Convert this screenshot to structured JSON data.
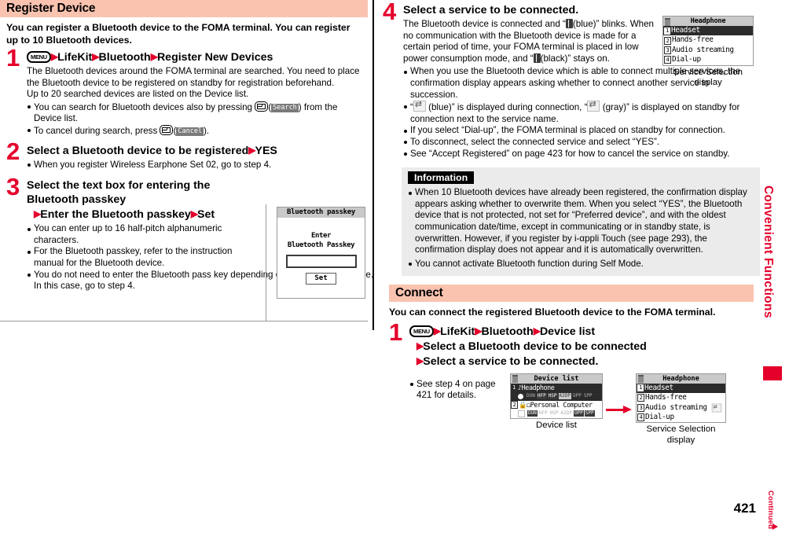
{
  "page": {
    "number": "421",
    "continued_label": "Continued",
    "side_tab": "Convenient Functions"
  },
  "left_column": {
    "section": {
      "title": "Register Device",
      "lead": "You can register a Bluetooth device to the FOMA terminal. You can register up to 10 Bluetooth devices."
    },
    "steps": [
      {
        "num": "1",
        "title_parts": [
          "LifeKit",
          "Bluetooth",
          "Register New Devices"
        ],
        "menu_key": "MENU",
        "body": [
          "The Bluetooth devices around the FOMA terminal are searched. You need to place the Bluetooth device to be registered on standby for registration beforehand.",
          "Up to 20 searched devices are listed on the Device list."
        ],
        "bullets": [
          {
            "pre": "You can search for Bluetooth devices also by pressing ",
            "key_icon": "mail-key-icon",
            "softkey": "Search",
            "post": ") from the Device list."
          },
          {
            "pre": "To cancel during search, press ",
            "key_icon": "mail-key-icon",
            "softkey": "Cancel",
            "post": ")."
          }
        ]
      },
      {
        "num": "2",
        "title": "Select a Bluetooth device to be registered",
        "title_tail": "YES",
        "bullets": [
          "When you register Wireless Earphone Set 02, go to step 4."
        ]
      },
      {
        "num": "3",
        "title_line1": "Select the text box for entering the",
        "title_line2": "Bluetooth passkey",
        "title_line3a": "Enter the Bluetooth passkey",
        "title_line3b": "Set",
        "bullets": [
          "You can enter up to 16 half-pitch alphanumeric characters.",
          "For the Bluetooth passkey, refer to the instruction manual for the Bluetooth device.",
          "You do not need to enter the Bluetooth pass key depending on the Bluetooth device. In this case, go to step 4."
        ]
      }
    ],
    "passkey_screenshot": {
      "title": "Bluetooth passkey",
      "label_line1": "Enter",
      "label_line2": "Bluetooth Passkey",
      "field_value": "",
      "button": "Set"
    }
  },
  "right_column": {
    "step4": {
      "num": "4",
      "title": "Select a service to be connected.",
      "body_pre": "The Bluetooth device is connected and “",
      "body_mid1": "(blue)” blinks. When no communication with the Bluetooth device is made for a certain period of time, your FOMA terminal is placed in low power consumption mode, and “",
      "body_mid2": "(black)” stays on.",
      "bullets": [
        "When you use the Bluetooth device which is able to connect multiple services, the confirmation display appears asking whether to connect another service in succession.",
        "If you select “Dial-up”, the FOMA terminal is placed on standby for connection.",
        "To disconnect, select the connected service and select “YES”.",
        "See “Accept Registered” on page 423 for how to cancel the service on standby."
      ],
      "bullet_icon_pre": "“",
      "bullet_icon_mid": "(blue)” is displayed during connection, “",
      "bullet_icon_post": "(gray)” is displayed on standby for connection next to the service name."
    },
    "service_screenshot_top": {
      "title": "Headphone",
      "rows": [
        {
          "n": "1",
          "label": "Headset",
          "selected": true
        },
        {
          "n": "2",
          "label": "Hands-free",
          "selected": false
        },
        {
          "n": "3",
          "label": "Audio streaming",
          "selected": false,
          "icon": true
        },
        {
          "n": "4",
          "label": "Dial-up",
          "selected": false
        }
      ],
      "caption_line1": "Service Selection",
      "caption_line2": "display"
    },
    "information": {
      "tab": "Information",
      "items": [
        "When 10 Bluetooth devices have already been registered, the confirmation display appears asking whether to overwrite them. When you select “YES”, the Bluetooth device that is not protected, not set for “Preferred device”, and with the oldest communication date/time, except in communicating or in standby state, is overwritten. However, if you register by i-αppli Touch (see page 293), the confirmation display does not appear and it is automatically overwritten.",
        "You cannot activate Bluetooth function during Self Mode."
      ]
    },
    "connect_section": {
      "title": "Connect",
      "lead": "You can connect the registered Bluetooth device to the FOMA terminal.",
      "step": {
        "num": "1",
        "menu_key": "MENU",
        "title_parts": [
          "LifeKit",
          "Bluetooth",
          "Device list"
        ],
        "line2": "Select a Bluetooth device to be connected",
        "line3": "Select a service to be connected.",
        "bullets": [
          "See step 4 on page 421 for details."
        ]
      },
      "device_list_shot": {
        "title": "Device list",
        "caption": "Device list",
        "rows": [
          {
            "n": "1",
            "label": "Headphone",
            "selected": true,
            "profiles": [
              {
                "t": "DUN",
                "s": "off"
              },
              {
                "t": "HFP",
                "s": "on"
              },
              {
                "t": "HSP",
                "s": "on"
              },
              {
                "t": "A2DP",
                "s": "hl"
              },
              {
                "t": "OPP",
                "s": "off"
              },
              {
                "t": "SPP",
                "s": "off"
              }
            ]
          },
          {
            "n": "2",
            "label": "Personal Computer",
            "selected": false,
            "locked": true,
            "profiles": [
              {
                "t": "DUN",
                "s": "on"
              },
              {
                "t": "HFP",
                "s": "off"
              },
              {
                "t": "HSP",
                "s": "off"
              },
              {
                "t": "A2DP",
                "s": "off"
              },
              {
                "t": "OPP",
                "s": "on"
              },
              {
                "t": "SPP",
                "s": "on"
              }
            ]
          }
        ]
      },
      "service_shot": {
        "title": "Headphone",
        "rows": [
          {
            "n": "1",
            "label": "Headset",
            "selected": true
          },
          {
            "n": "2",
            "label": "Hands-free",
            "selected": false
          },
          {
            "n": "3",
            "label": "Audio streaming",
            "selected": false,
            "icon": true
          },
          {
            "n": "4",
            "label": "Dial-up",
            "selected": false
          }
        ],
        "caption_line1": "Service Selection",
        "caption_line2": "display"
      }
    }
  },
  "colors": {
    "accent_red": "#e4002b",
    "header_peach": "#f9c3b0",
    "info_gray": "#ebebeb"
  }
}
